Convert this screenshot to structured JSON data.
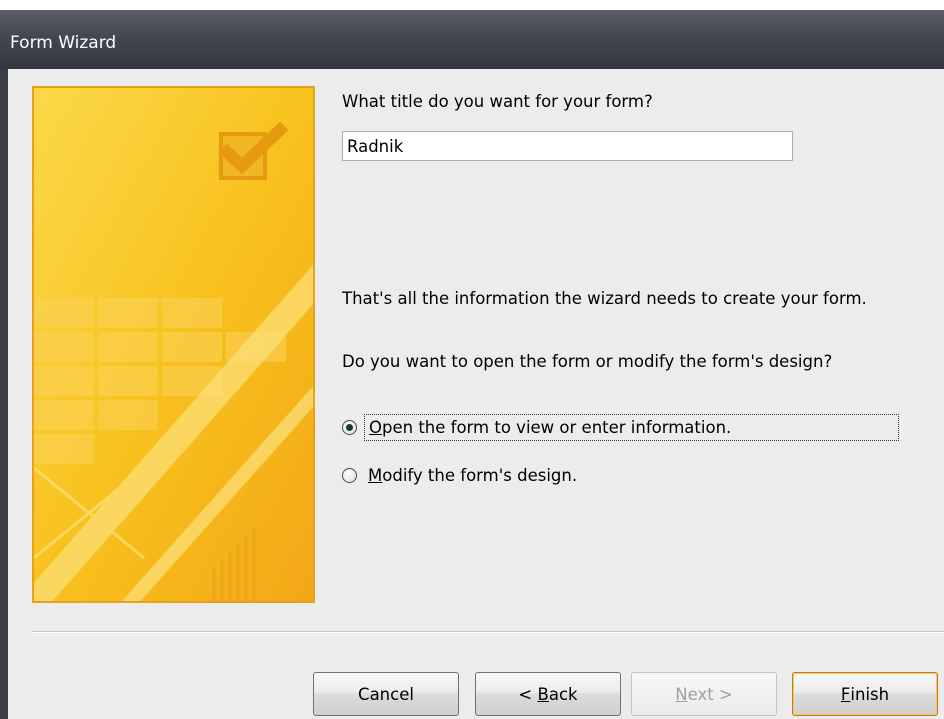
{
  "window": {
    "title": "Form Wizard"
  },
  "question_title": "What title do you want for your form?",
  "form_title_value": "Radnik",
  "info_text": "That's all the information the wizard needs to create your form.",
  "question_open": "Do you want to open the form or modify the form's design?",
  "options": [
    {
      "mnemonic": "O",
      "rest": "pen the form to view or enter information.",
      "selected": true
    },
    {
      "mnemonic": "M",
      "rest": "odify the form's design.",
      "selected": false
    }
  ],
  "buttons": {
    "cancel": "Cancel",
    "back_prefix": "< ",
    "back_mnemonic": "B",
    "back_rest": "ack",
    "next_mnemonic": "N",
    "next_rest": "ext >",
    "finish_mnemonic": "F",
    "finish_rest": "inish"
  },
  "colors": {
    "titlebar": "#434751",
    "art_yellow": "#f8c21e",
    "art_border": "#e8a21a",
    "dialog_bg": "#ececec"
  },
  "icons": [
    "checkmark-icon"
  ]
}
